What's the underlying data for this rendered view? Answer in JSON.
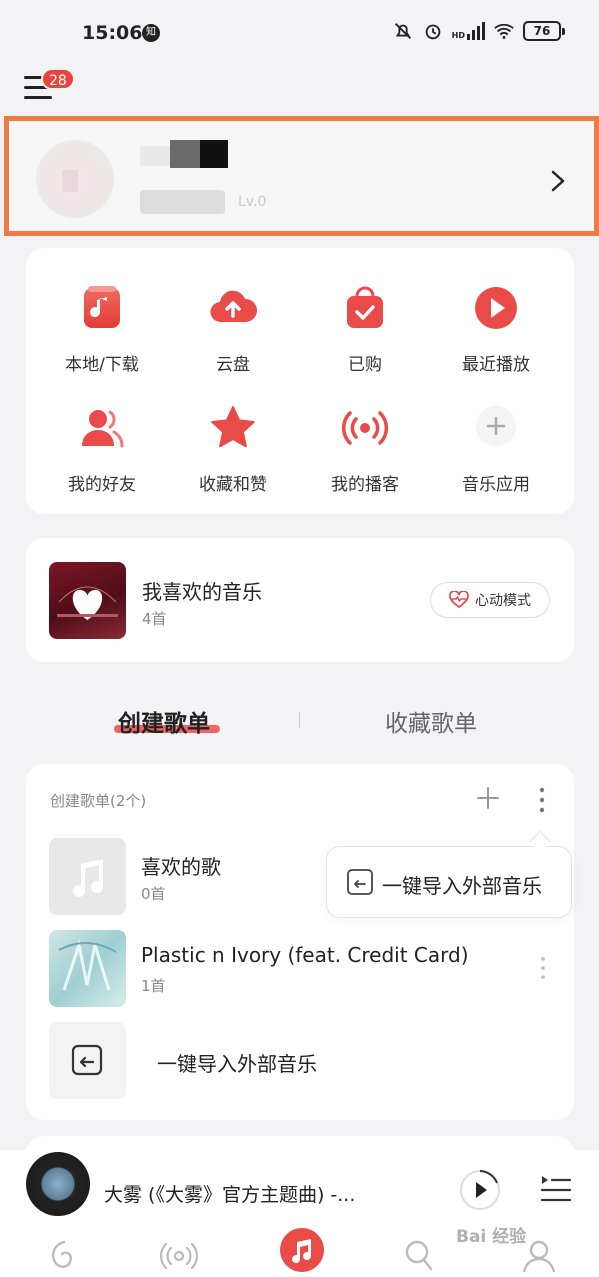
{
  "status_bar": {
    "time": "15:06",
    "app_badge": "知",
    "network": "HD",
    "battery": "76"
  },
  "menu": {
    "badge_count": "28"
  },
  "profile": {
    "level": "Lv.0"
  },
  "shortcuts": [
    {
      "label": "本地/下载",
      "icon": "local-download-icon"
    },
    {
      "label": "云盘",
      "icon": "cloud-upload-icon"
    },
    {
      "label": "已购",
      "icon": "purchased-bag-icon"
    },
    {
      "label": "最近播放",
      "icon": "recent-play-icon"
    },
    {
      "label": "我的好友",
      "icon": "friends-icon"
    },
    {
      "label": "收藏和赞",
      "icon": "star-icon"
    },
    {
      "label": "我的播客",
      "icon": "podcast-icon"
    },
    {
      "label": "音乐应用",
      "icon": "add-icon"
    }
  ],
  "liked_music": {
    "title": "我喜欢的音乐",
    "count": "4首",
    "heart_mode_label": "心动模式"
  },
  "tabs": {
    "created": "创建歌单",
    "collected": "收藏歌单"
  },
  "playlists": {
    "header": "创建歌单(2个)",
    "items": [
      {
        "title": "喜欢的歌",
        "count": "0首"
      },
      {
        "title": "Plastic n Ivory (feat. Credit Card)",
        "count": "1首"
      },
      {
        "title": "一键导入外部音乐"
      }
    ],
    "popup_label": "一键导入外部音乐"
  },
  "player": {
    "title": "大雾 (《大雾》官方主题曲) -..."
  },
  "watermark": "Bai 经验",
  "colors": {
    "accent": "#e94b48",
    "highlight_border": "#ee7a45"
  }
}
